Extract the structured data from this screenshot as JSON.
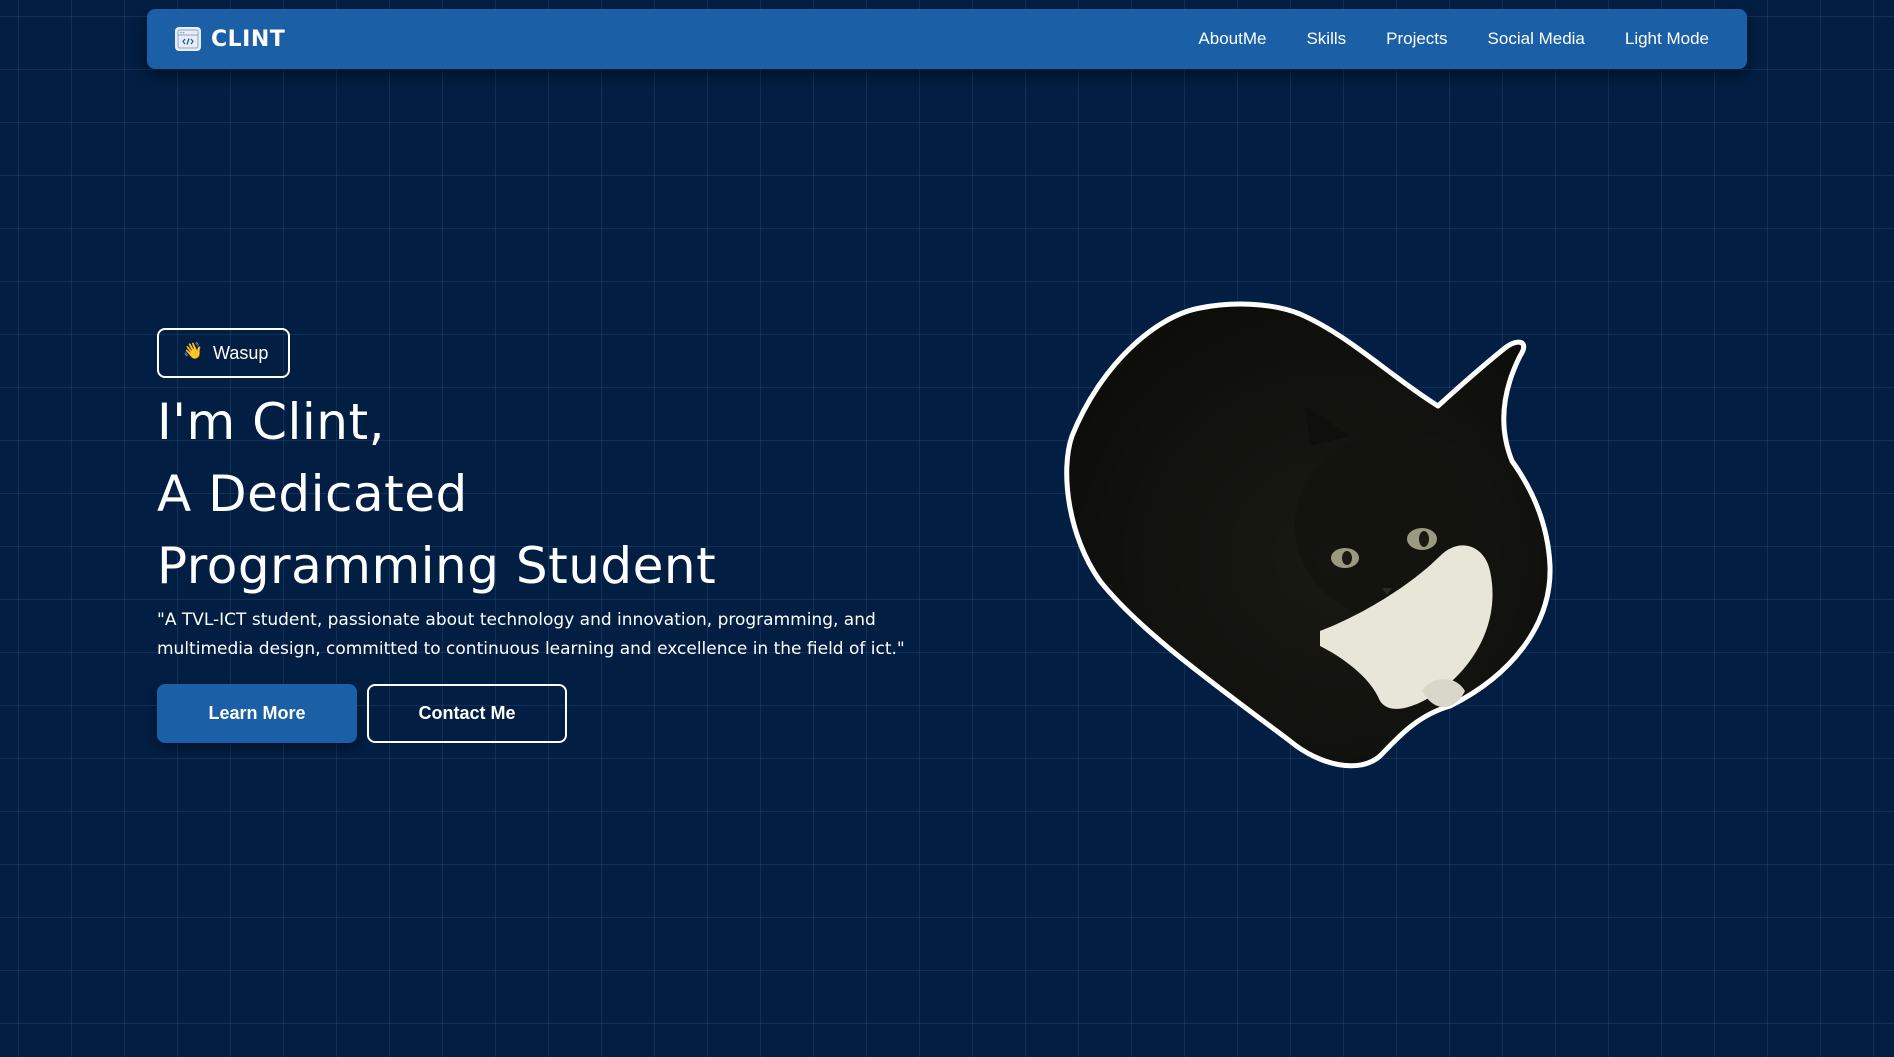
{
  "navbar": {
    "brand": "CLINT",
    "brand_icon": "code-window-icon",
    "links": [
      {
        "label": "AboutMe"
      },
      {
        "label": "Skills"
      },
      {
        "label": "Projects"
      },
      {
        "label": "Social Media"
      },
      {
        "label": "Light Mode"
      }
    ]
  },
  "hero": {
    "badge_icon": "waving-hand-icon",
    "badge_emoji": "👋",
    "badge_label": "Wasup",
    "headline_line1": "I'm Clint,",
    "headline_line2": "A Dedicated",
    "headline_line3": "Programming Student",
    "description": "\"A TVL-ICT student, passionate about technology and innovation, programming, and multimedia design, committed to continuous learning and excellence in the field of ict.\"",
    "primary_button": "Learn More",
    "secondary_button": "Contact Me",
    "image": "black-and-white-cat-sticker"
  },
  "colors": {
    "background": "#021e42",
    "grid_line": "#2a4f7a",
    "navbar": "#1b5fa6",
    "primary_button": "#1b5fa6",
    "text": "#ffffff"
  }
}
